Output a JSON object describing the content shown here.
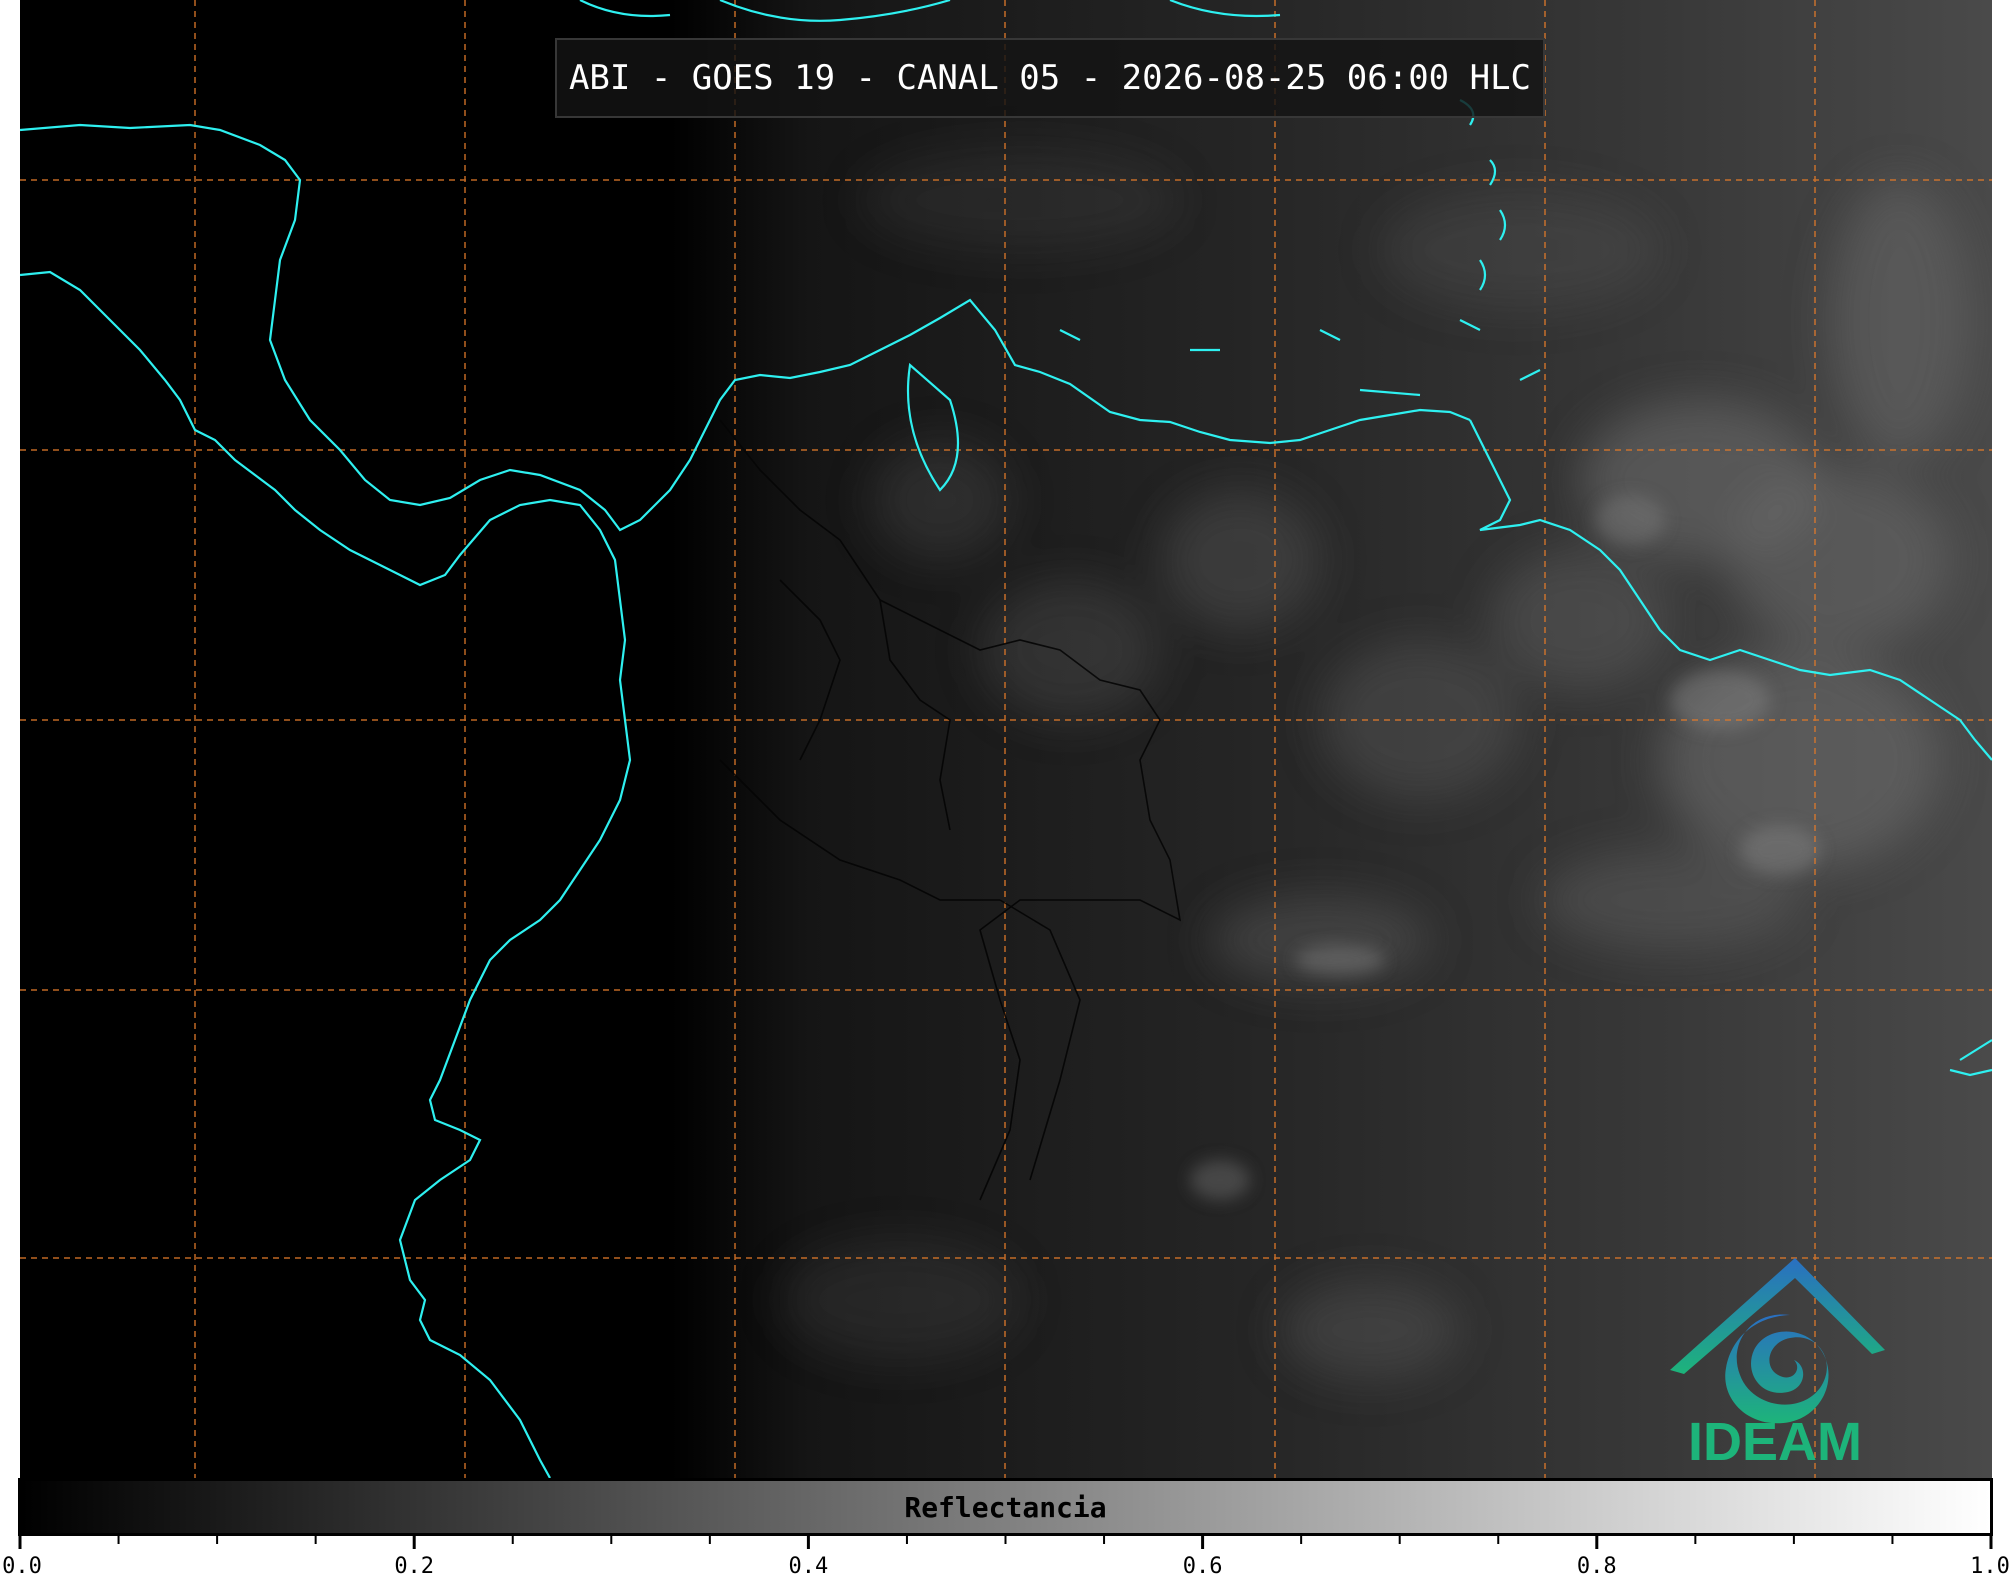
{
  "title": "ABI - GOES 19 - CANAL 05 - 2026-08-25 06:00 HLC",
  "colorbar": {
    "label": "Reflectancia",
    "range": [
      0.0,
      1.0
    ],
    "major_ticks": [
      "0.0",
      "0.2",
      "0.4",
      "0.6",
      "0.8",
      "1.0"
    ],
    "minor_tick_step": 0.05,
    "colormap": "grayscale"
  },
  "logo": {
    "text": "IDEAM",
    "colors": {
      "top": "#2a6fc2",
      "bottom": "#1db47a"
    }
  },
  "map": {
    "coastline_color": "#2ef0f0",
    "border_color": "#000000",
    "gridline_color": "#e07a2a",
    "gridline_style": "dashed",
    "background": "satellite-grayscale"
  }
}
